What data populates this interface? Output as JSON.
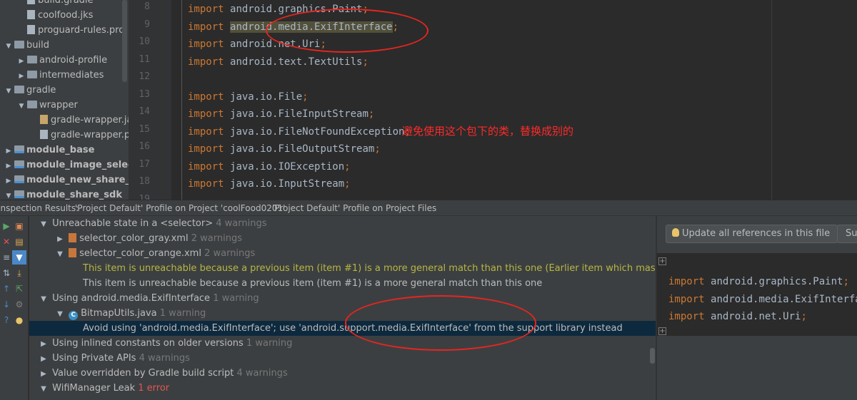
{
  "project_tree": {
    "items": [
      {
        "label": "build.gradle",
        "indent": 2,
        "icon": "gradle-file-icon"
      },
      {
        "label": "coolfood.jks",
        "indent": 2,
        "icon": "file-icon"
      },
      {
        "label": "proguard-rules.pro",
        "indent": 2,
        "icon": "file-icon"
      },
      {
        "label": "build",
        "indent": 1,
        "icon": "folder-icon",
        "arrow": "▼"
      },
      {
        "label": "android-profile",
        "indent": 2,
        "icon": "folder-icon",
        "arrow": "▶"
      },
      {
        "label": "intermediates",
        "indent": 2,
        "icon": "folder-icon",
        "arrow": "▶"
      },
      {
        "label": "gradle",
        "indent": 1,
        "icon": "folder-icon",
        "arrow": "▼"
      },
      {
        "label": "wrapper",
        "indent": 2,
        "icon": "folder-icon",
        "arrow": "▼"
      },
      {
        "label": "gradle-wrapper.jar",
        "indent": 3,
        "icon": "jar-icon"
      },
      {
        "label": "gradle-wrapper.properties",
        "indent": 3,
        "icon": "file-icon"
      },
      {
        "label": "module_base",
        "indent": 1,
        "icon": "module-folder-icon",
        "arrow": "▶",
        "bold": true
      },
      {
        "label": "module_image_selector",
        "indent": 1,
        "icon": "module-folder-icon",
        "arrow": "▶",
        "bold": true
      },
      {
        "label": "module_new_share_sdk",
        "indent": 1,
        "icon": "module-folder-icon",
        "arrow": "▶",
        "bold": true
      },
      {
        "label": "module_share_sdk",
        "indent": 1,
        "icon": "module-folder-icon",
        "arrow": "▼",
        "bold": true
      }
    ]
  },
  "editor": {
    "line_numbers": [
      "8",
      "9",
      "10",
      "11",
      "12",
      "13",
      "14",
      "15",
      "16",
      "17",
      "18",
      "19"
    ],
    "lines": [
      {
        "kw": "import",
        "pkg": "android.graphics.Paint",
        "semi": ";"
      },
      {
        "kw": "import",
        "pkg": "android.media.ExifInterface",
        "semi": ";"
      },
      {
        "kw": "import",
        "pkg": "android.net.Uri",
        "semi": ";"
      },
      {
        "kw": "import",
        "pkg": "android.text.TextUtils",
        "semi": ";"
      },
      {
        "kw": "",
        "pkg": "",
        "semi": ""
      },
      {
        "kw": "import",
        "pkg": "java.io.File",
        "semi": ";"
      },
      {
        "kw": "import",
        "pkg": "java.io.FileInputStream",
        "semi": ";"
      },
      {
        "kw": "import",
        "pkg": "java.io.FileNotFoundException",
        "semi": ";"
      },
      {
        "kw": "import",
        "pkg": "java.io.FileOutputStream",
        "semi": ";"
      },
      {
        "kw": "import",
        "pkg": "java.io.IOException",
        "semi": ";"
      },
      {
        "kw": "import",
        "pkg": "java.io.InputStream",
        "semi": ";"
      }
    ],
    "annotation_comment": "避免使用这个包下的类，替换成别的"
  },
  "inspection_tabs": [
    "Inspection Results:",
    "'Project Default' Profile on Project 'coolFood0201'",
    "'Project Default' Profile on Project Files"
  ],
  "inspection_tree": [
    {
      "arrow": "▼",
      "label": "Unreachable state in a <selector>",
      "count": "4 warnings",
      "indent": 0
    },
    {
      "arrow": "▶",
      "label": "selector_color_gray.xml",
      "count": "2 warnings",
      "indent": 1,
      "icon": "xml-file-icon"
    },
    {
      "arrow": "▼",
      "label": "selector_color_orange.xml",
      "count": "2 warnings",
      "indent": 1,
      "icon": "xml-file-icon"
    },
    {
      "arrow": "",
      "label": "This item is unreachable because a previous item (item #1) is a more general match than this one (Earlier item which masks item)",
      "count": "",
      "indent": 2,
      "style": "ylw"
    },
    {
      "arrow": "",
      "label": "This item is unreachable because a previous item (item #1) is a more general match than this one",
      "count": "",
      "indent": 2
    },
    {
      "arrow": "▼",
      "label": "Using android.media.ExifInterface",
      "count": "1 warning",
      "indent": 0
    },
    {
      "arrow": "▼",
      "label": "BitmapUtils.java",
      "count": "1 warning",
      "indent": 1,
      "icon": "java-class-icon"
    },
    {
      "arrow": "",
      "label": "Avoid using 'android.media.ExifInterface'; use 'android.support.media.ExifInterface' from the support library instead",
      "count": "",
      "indent": 2,
      "selected": true
    },
    {
      "arrow": "▶",
      "label": "Using inlined constants on older versions",
      "count": "1 warning",
      "indent": 0
    },
    {
      "arrow": "▶",
      "label": "Using Private APIs",
      "count": "4 warnings",
      "indent": 0
    },
    {
      "arrow": "▶",
      "label": "Value overridden by Gradle build script",
      "count": "4 warnings",
      "indent": 0
    },
    {
      "arrow": "▼",
      "label": "WifiManager Leak",
      "count": "1 error",
      "indent": 0,
      "count_style": "err"
    }
  ],
  "preview": {
    "update_button": "Update all references in this file",
    "second_button": "Su",
    "lines": [
      {
        "kw": "import",
        "pkg": "android.graphics.Paint",
        "semi": ";"
      },
      {
        "kw": "import",
        "pkg": "android.media.ExifInterface",
        "semi": ";"
      },
      {
        "kw": "import",
        "pkg": "android.net.Uri",
        "semi": ";"
      }
    ]
  },
  "colors": {
    "keyword": "#cc7832",
    "annotation": "#e8251f",
    "error": "#e05555",
    "selection": "#0d293e"
  }
}
